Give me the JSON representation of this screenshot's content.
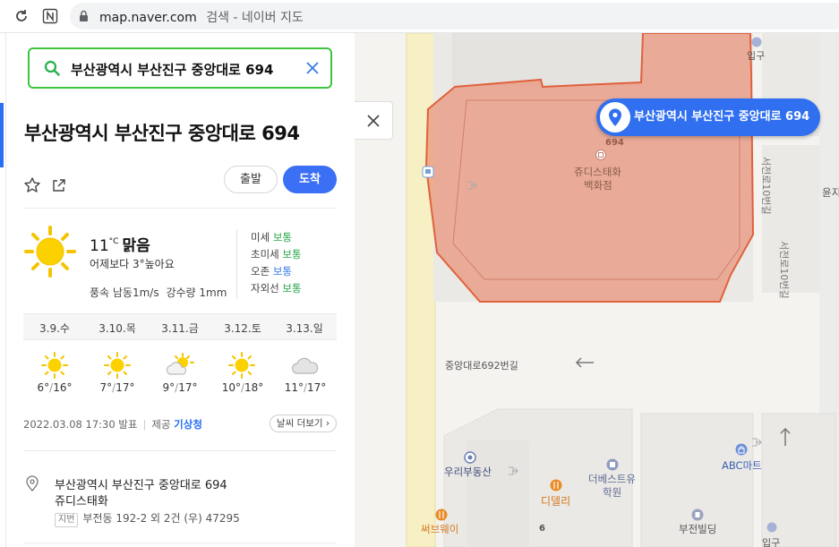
{
  "browser": {
    "url": "map.naver.com",
    "page_title": "검색 - 네이버 지도"
  },
  "search": {
    "query": "부산광역시 부산진구 중앙대로 694"
  },
  "place": {
    "title": "부산광역시 부산진구 중앙대로 694",
    "depart_label": "출발",
    "arrive_label": "도착"
  },
  "weather": {
    "temp": "11",
    "unit": "°C",
    "condition": "맑음",
    "compare": "어제보다 3°높아요",
    "wind": "풍속 남동1m/s",
    "rain": "강수량 1mm",
    "air": [
      {
        "label": "미세",
        "value": "보통",
        "color": "#29a84a"
      },
      {
        "label": "초미세",
        "value": "보통",
        "color": "#29a84a"
      },
      {
        "label": "오존",
        "value": "보통",
        "color": "#3b7be6"
      },
      {
        "label": "자외선",
        "value": "보통",
        "color": "#29a84a"
      }
    ],
    "forecast": [
      {
        "day": "3.9.수",
        "icon": "sun-icon",
        "low": "6°",
        "high": "16°"
      },
      {
        "day": "3.10.목",
        "icon": "sun-icon",
        "low": "7°",
        "high": "17°"
      },
      {
        "day": "3.11.금",
        "icon": "partly-cloudy-icon",
        "low": "9°",
        "high": "17°"
      },
      {
        "day": "3.12.토",
        "icon": "sun-icon",
        "low": "10°",
        "high": "18°"
      },
      {
        "day": "3.13.일",
        "icon": "cloud-icon",
        "low": "11°",
        "high": "17°"
      }
    ],
    "issued": "2022.03.08 17:30 발표",
    "provider_prefix": "제공",
    "provider": "기상청",
    "more_label": "날씨 더보기"
  },
  "address": {
    "road": "부산광역시 부산진구 중앙대로 694",
    "building": "쥬디스태화",
    "jibun_tag": "지번",
    "jibun": "부전동 192-2 외 2건 (우) 47295"
  },
  "map": {
    "callout": "부산광역시 부산진구 중앙대로 694",
    "labels": {
      "building_name": "쥬디스태화",
      "building_sub": "백화점",
      "building_no": "694",
      "road1": "중앙대로692번길",
      "road2": "서전로10번길",
      "road3": "서전로10번길",
      "entrance1": "입구",
      "entrance2": "입구",
      "realty": "우리부동산",
      "dideli": "디델리",
      "academy1": "더베스트유",
      "academy2": "학원",
      "abc": "ABC마트",
      "bujeon": "부전빌딩",
      "subway": "써브웨이",
      "six": "6",
      "yunji": "윤지"
    },
    "colors": {
      "highlight": "#e8937a",
      "accent": "#2f6ff0"
    }
  }
}
